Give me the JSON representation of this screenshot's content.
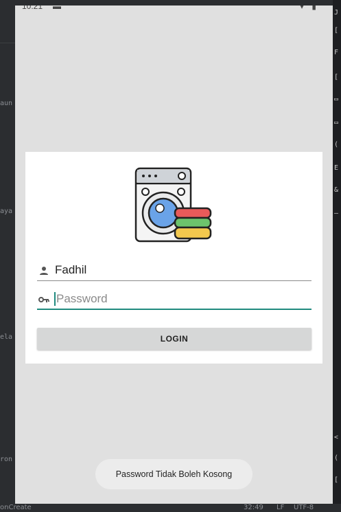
{
  "ide": {
    "gutter_labels": [
      "aun",
      "aya",
      "ela",
      "ron"
    ],
    "right_glyphs": [
      "J",
      "[",
      "F",
      "[",
      "▭",
      "▭",
      "(",
      "E",
      "&",
      "—",
      "<",
      "(",
      "["
    ],
    "status_left": "onCreate",
    "status_pos": "32:49",
    "status_lf": "LF",
    "status_enc": "UTF-8"
  },
  "device": {
    "time": "10:21",
    "status_dash": "▬",
    "status_icons": "▾ ▮"
  },
  "login": {
    "username_value": "Fadhil",
    "password_placeholder": "Password",
    "login_label": "LOGIN"
  },
  "toast": {
    "message": "Password Tidak Boleh Kosong"
  },
  "colors": {
    "accent": "#1f8a7e",
    "screen_bg": "#e0e0e0",
    "card_bg": "#ffffff",
    "button_bg": "#d6d7d7"
  }
}
